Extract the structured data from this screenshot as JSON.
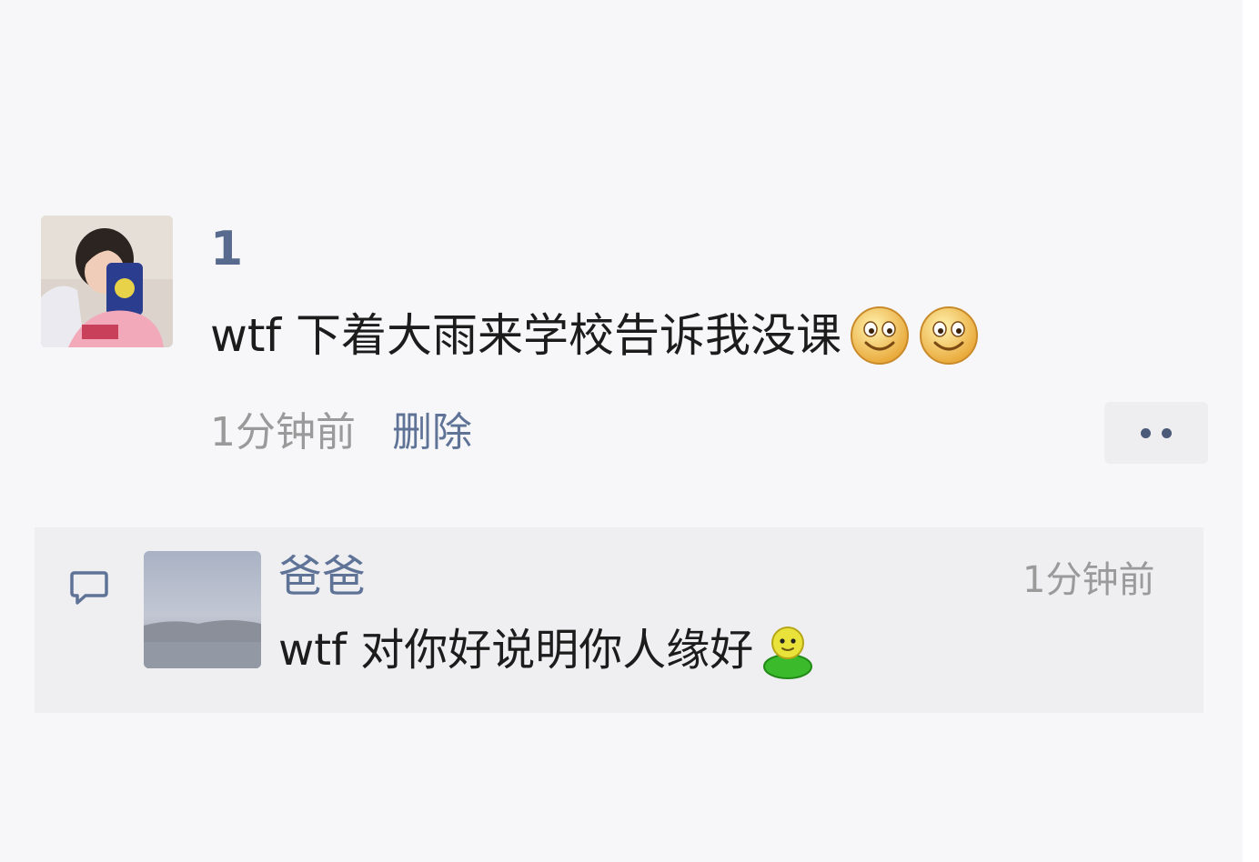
{
  "post": {
    "username": "1",
    "text": "wtf 下着大雨来学校告诉我没课",
    "emojis": [
      "smile-emoji",
      "smile-emoji"
    ],
    "time": "1分钟前",
    "delete_label": "删除"
  },
  "more_button": {
    "icon": "more-dots-icon"
  },
  "comments": [
    {
      "name": "爸爸",
      "time": "1分钟前",
      "text": "wtf 对你好说明你人缘好",
      "emoji": "green-person-emoji"
    }
  ],
  "colors": {
    "background": "#f7f7f9",
    "link_blue": "#5f7397",
    "username_blue": "#586b8f",
    "text_dark": "#1c1c1c",
    "meta_gray": "#9a9a9a",
    "comment_panel": "#efeff2"
  }
}
